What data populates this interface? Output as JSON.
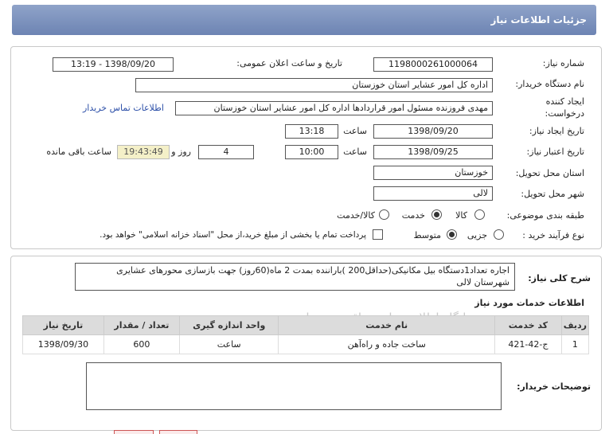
{
  "page": {
    "title": "جزئیات اطلاعات نیاز"
  },
  "need": {
    "number_label": "شماره نیاز:",
    "number_value": "1198000261000064",
    "announce_label": "تاریخ و ساعت اعلان عمومی:",
    "announce_value": "1398/09/20 - 13:19",
    "buyer_label": "نام دستگاه خریدار:",
    "buyer_value": "اداره کل امور عشایر استان خوزستان",
    "creator_label_1": "ایجاد کننده",
    "creator_label_2": "درخواست:",
    "creator_value": "مهدی فروزنده مسئول امور قراردادها اداره کل امور عشایر استان خوزستان",
    "contact_link": "اطلاعات تماس خریدار",
    "created_label": "تاریخ ایجاد نیاز:",
    "created_date": "1398/09/20",
    "time_label": "ساعت",
    "created_time": "13:18",
    "validity_label": "تاریخ اعتبار نیاز:",
    "validity_date": "1398/09/25",
    "validity_time": "10:00",
    "days_value": "4",
    "days_label": "روز و",
    "remaining_time": "19:43:49",
    "remaining_label": "ساعت باقی مانده",
    "province_label": "استان محل تحویل:",
    "province_value": "خوزستان",
    "city_label": "شهر محل تحویل:",
    "city_value": "لالی",
    "category_label": "طبقه بندی موضوعی:",
    "category_options": [
      "کالا",
      "خدمت",
      "کالا/خدمت"
    ],
    "category_selected": "خدمت",
    "process_label": "نوع فرآیند خرید :",
    "process_options": [
      "جزیی",
      "متوسط"
    ],
    "process_selected": "متوسط",
    "payment_note": "پرداخت تمام یا بخشی از مبلغ خرید،از محل \"اسناد خزانه اسلامی\" خواهد بود."
  },
  "summary": {
    "label": "شرح کلی نیاز:",
    "text": "اجاره تعداد1دستگاه بیل مکانیکی(حداقل200 )باراننده بمدت 2 ماه(60روز) جهت بازسازی محورهای عشایری شهرستان لالی"
  },
  "services": {
    "section_title": "اطلاعات خدمات مورد نیاز",
    "headers": [
      "ردیف",
      "کد خدمت",
      "نام خدمت",
      "واحد اندازه گیری",
      "تعداد / مقدار",
      "تاریخ نیاز"
    ],
    "rows": [
      [
        "1",
        "ج-42-421",
        "ساخت جاده و راه‌آهن",
        "ساعت",
        "600",
        "1398/09/30"
      ]
    ]
  },
  "buyer_notes": {
    "label": "توضیحات خریدار:"
  },
  "watermark": "پایگاه اطلاع رسانی مناقصه و مزایده",
  "colors": {
    "title_bar": "#7a8fbf",
    "link": "#2c4fa8",
    "timer_bg": "#f4f0c8"
  }
}
